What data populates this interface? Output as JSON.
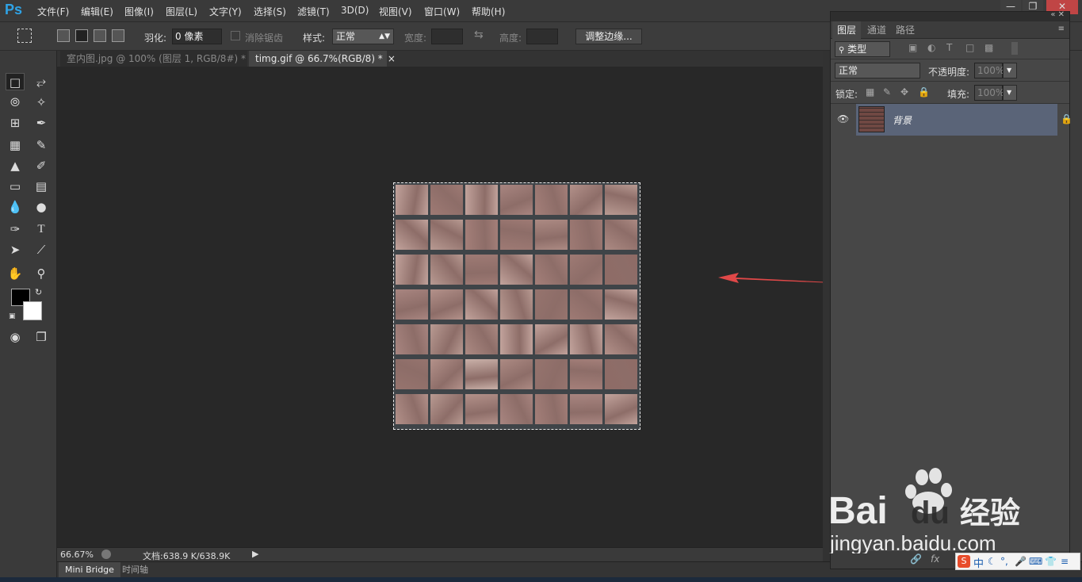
{
  "app": {
    "logo": "Ps"
  },
  "menu": [
    "文件(F)",
    "编辑(E)",
    "图像(I)",
    "图层(L)",
    "文字(Y)",
    "选择(S)",
    "滤镜(T)",
    "3D(D)",
    "视图(V)",
    "窗口(W)",
    "帮助(H)"
  ],
  "options": {
    "feather_label": "羽化:",
    "feather_value": "0 像素",
    "antialias_label": "消除锯齿",
    "style_label": "样式:",
    "style_value": "正常",
    "width_label": "宽度:",
    "height_label": "高度:",
    "refine_edge": "调整边缘..."
  },
  "tabs": [
    {
      "label": "室内图.jpg @ 100% (图层 1, RGB/8#) *",
      "close": "×",
      "active": false
    },
    {
      "label": "timg.gif @ 66.7%(RGB/8) *",
      "close": "×",
      "active": true
    }
  ],
  "status": {
    "zoom": "66.67%",
    "doc": "文档:638.9 K/638.9K"
  },
  "bottom_tabs": [
    "Mini Bridge",
    "时间轴"
  ],
  "layers_panel": {
    "tabs": [
      "图层",
      "通道",
      "路径"
    ],
    "filter_kind": "类型",
    "blend_mode": "正常",
    "opacity_label": "不透明度:",
    "opacity_value": "100%",
    "lock_label": "锁定:",
    "fill_label": "填充:",
    "fill_value": "100%",
    "layer_name": "背景"
  },
  "watermark": {
    "brand": "Bai",
    "brand2": "du",
    "brand3": "经验",
    "url": "jingyan.baidu.com"
  },
  "ime": {
    "label": "中"
  },
  "colors": {
    "accent": "#2fa3e6",
    "arrow": "#e04848",
    "selected_layer": "#5a6478"
  }
}
